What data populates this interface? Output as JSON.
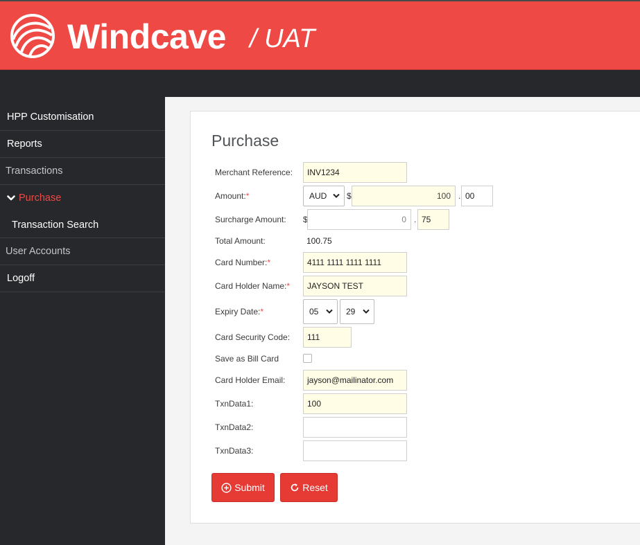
{
  "header": {
    "brand": "Windcave",
    "environment": "/ UAT",
    "bg_color": "#ee4944"
  },
  "sidebar": {
    "items": [
      {
        "label": "HPP Customisation"
      },
      {
        "label": "Reports"
      },
      {
        "label": "Transactions"
      },
      {
        "label": "Purchase",
        "active": true,
        "icon": "chevron-down-icon"
      },
      {
        "label": "Transaction Search"
      },
      {
        "label": "User Accounts"
      },
      {
        "label": "Logoff"
      }
    ]
  },
  "form": {
    "title": "Purchase",
    "merchant_reference": {
      "label": "Merchant Reference:",
      "value": "INV1234"
    },
    "amount": {
      "label": "Amount:",
      "required": "*",
      "currency": "AUD",
      "currency_symbol": "$",
      "dollars": "100",
      "decimal_point": ".",
      "cents": "00"
    },
    "surcharge": {
      "label": "Surcharge Amount:",
      "currency_symbol": "$",
      "dollars": "0",
      "decimal_point": ".",
      "cents": "75"
    },
    "total": {
      "label": "Total Amount:",
      "value": "100.75"
    },
    "card_number": {
      "label": "Card Number:",
      "required": "*",
      "value": "4111 1111 1111 1111"
    },
    "card_holder_name": {
      "label": "Card Holder Name:",
      "required": "*",
      "value": "JAYSON TEST"
    },
    "expiry": {
      "label": "Expiry Date:",
      "required": "*",
      "month": "05",
      "year": "29"
    },
    "security_code": {
      "label": "Card Security Code:",
      "value": "111"
    },
    "save_bill_card": {
      "label": "Save as Bill Card",
      "checked": false
    },
    "email": {
      "label": "Card Holder Email:",
      "value": "jayson@mailinator.com"
    },
    "txndata1": {
      "label": "TxnData1:",
      "value": "100"
    },
    "txndata2": {
      "label": "TxnData2:",
      "value": ""
    },
    "txndata3": {
      "label": "TxnData3:",
      "value": ""
    },
    "submit_label": "Submit",
    "reset_label": "Reset"
  },
  "colors": {
    "accent": "#ee4944",
    "sidebar_bg": "#26282b",
    "input_highlight": "#fffde6"
  }
}
